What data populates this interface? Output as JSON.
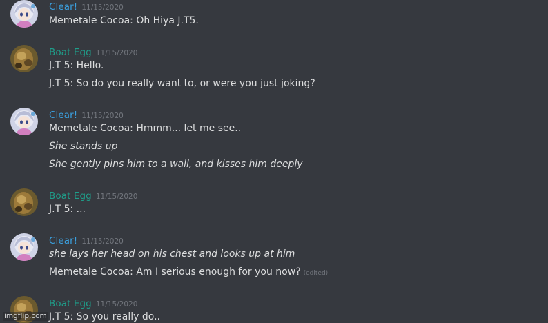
{
  "messages": [
    {
      "author": "Clear!",
      "author_color": "#3ba1e0",
      "avatar": "anime-girl-avatar",
      "timestamp": "11/15/2020",
      "lines": [
        {
          "text": "Memetale Cocoa: Oh Hiya J.T5."
        }
      ]
    },
    {
      "author": "Boat Egg",
      "author_color": "#1f9e8a",
      "avatar": "egg-avatar",
      "timestamp": "11/15/2020",
      "lines": [
        {
          "text": "J.T 5: Hello."
        },
        {
          "text": "J.T 5: So do you really want to, or were you just joking?"
        }
      ]
    },
    {
      "author": "Clear!",
      "author_color": "#3ba1e0",
      "avatar": "anime-girl-avatar",
      "timestamp": "11/15/2020",
      "lines": [
        {
          "text": "Memetale Cocoa: Hmmm... let me see.."
        },
        {
          "text": "She stands up"
        },
        {
          "text": "She gently pins him to a wall, and kisses him deeply"
        }
      ]
    },
    {
      "author": "Boat Egg",
      "author_color": "#1f9e8a",
      "avatar": "egg-avatar",
      "timestamp": "11/15/2020",
      "lines": [
        {
          "text": "J.T 5: ..."
        }
      ]
    },
    {
      "author": "Clear!",
      "author_color": "#3ba1e0",
      "avatar": "anime-girl-avatar",
      "timestamp": "11/15/2020",
      "lines": [
        {
          "text": "she lays her head on his chest and looks up at him"
        },
        {
          "text": "Memetale Cocoa: Am I serious enough for you now?",
          "edited": "(edited)"
        }
      ]
    },
    {
      "author": "Boat Egg",
      "author_color": "#1f9e8a",
      "avatar": "egg-avatar",
      "timestamp": "11/15/2020",
      "lines": [
        {
          "text": "J.T 5: So you really do.."
        }
      ]
    }
  ],
  "watermark": "imgflip.com",
  "colors": {
    "background": "#36393f",
    "text": "#dcddde",
    "timestamp": "#72767d"
  }
}
